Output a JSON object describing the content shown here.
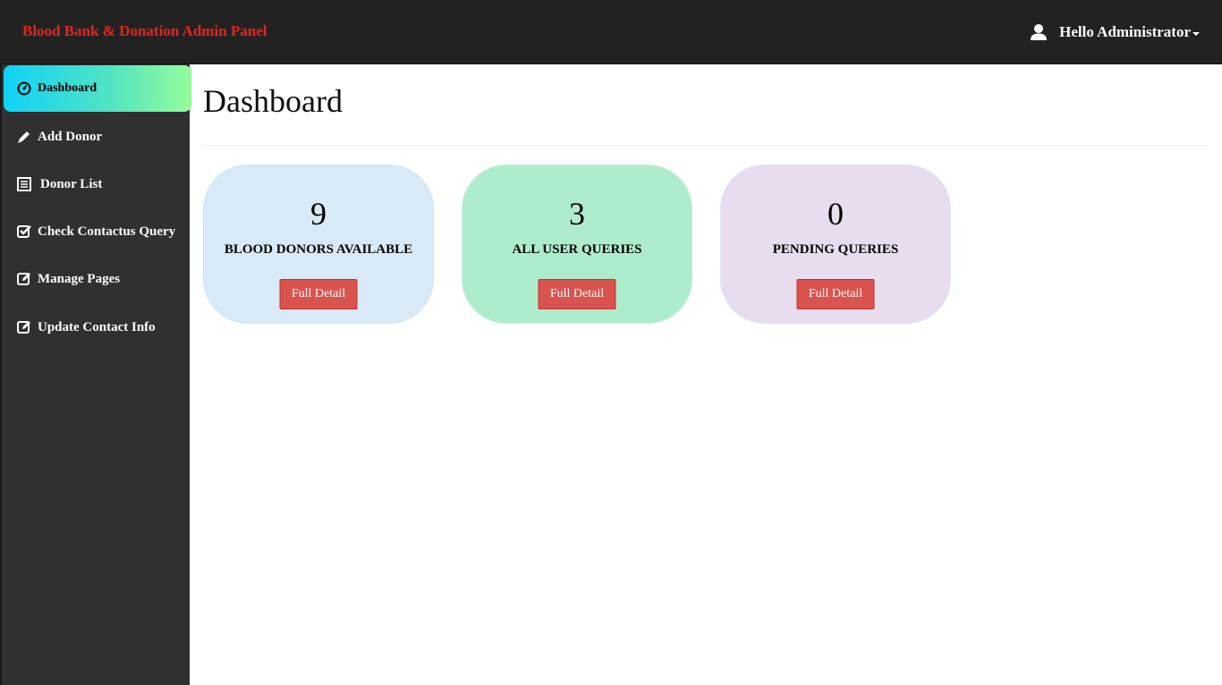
{
  "header": {
    "brand": "Blood Bank & Donation Admin Panel",
    "user_greeting": "Hello Administrator",
    "user_icon": "user-icon",
    "brand_color": "#e8231d"
  },
  "sidebar": {
    "items": [
      {
        "label": "Dashboard",
        "icon": "dashboard-icon",
        "active": true
      },
      {
        "label": "Add Donor",
        "icon": "pencil-icon",
        "active": false
      },
      {
        "label": "Donor List",
        "icon": "list-icon",
        "active": false
      },
      {
        "label": "Check Contactus Query",
        "icon": "check-square-icon",
        "active": false
      },
      {
        "label": "Manage Pages",
        "icon": "edit-icon",
        "active": false
      },
      {
        "label": "Update Contact Info",
        "icon": "edit-icon",
        "active": false
      }
    ]
  },
  "main": {
    "title": "Dashboard",
    "cards": [
      {
        "count": "9",
        "label": "BLOOD DONORS AVAILABLE",
        "button": "Full Detail",
        "color": "#d8eaf7"
      },
      {
        "count": "3",
        "label": "ALL USER QUERIES",
        "button": "Full Detail",
        "color": "#aeedcc"
      },
      {
        "count": "0",
        "label": "PENDING QUERIES",
        "button": "Full Detail",
        "color": "#e8dcef"
      }
    ]
  }
}
